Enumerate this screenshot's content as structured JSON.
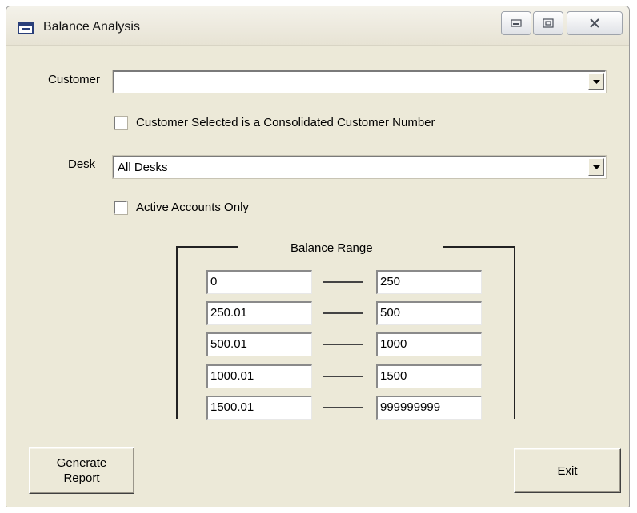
{
  "window": {
    "title": "Balance Analysis"
  },
  "customer": {
    "label": "Customer",
    "value": ""
  },
  "consolidated_checkbox": {
    "label": "Customer Selected is a Consolidated Customer Number",
    "checked": false
  },
  "desk": {
    "label": "Desk",
    "value": "All Desks"
  },
  "active_checkbox": {
    "label": "Active Accounts Only",
    "checked": false
  },
  "balance_range": {
    "title": "Balance Range",
    "rows": [
      {
        "from": "0",
        "to": "250"
      },
      {
        "from": "250.01",
        "to": "500"
      },
      {
        "from": "500.01",
        "to": "1000"
      },
      {
        "from": "1000.01",
        "to": "1500"
      },
      {
        "from": "1500.01",
        "to": "999999999"
      }
    ]
  },
  "buttons": {
    "generate": "Generate\nReport",
    "exit": "Exit"
  }
}
